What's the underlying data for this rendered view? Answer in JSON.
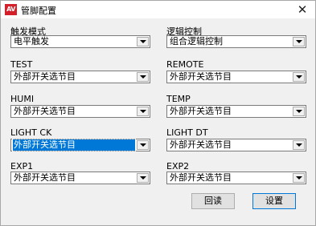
{
  "window": {
    "title": "管脚配置",
    "icon": "app-icon-red"
  },
  "fields": {
    "trigger_mode": {
      "label": "触发模式",
      "value": "电平触发"
    },
    "logic_control": {
      "label": "逻辑控制",
      "value": "组合逻辑控制"
    },
    "test": {
      "label": "TEST",
      "value": "外部开关选节目"
    },
    "remote": {
      "label": "REMOTE",
      "value": "外部开关选节目"
    },
    "humi": {
      "label": "HUMI",
      "value": "外部开关选节目"
    },
    "temp": {
      "label": "TEMP",
      "value": "外部开关选节目"
    },
    "light_ck": {
      "label": "LIGHT CK",
      "value": "外部开关选节目"
    },
    "light_dt": {
      "label": "LIGHT DT",
      "value": "外部开关选节目"
    },
    "exp1": {
      "label": "EXP1",
      "value": "外部开关选节目"
    },
    "exp2": {
      "label": "EXP2",
      "value": "外部开关选节目"
    }
  },
  "buttons": {
    "readback": "回读",
    "set": "设置"
  },
  "colors": {
    "selection": "#0078d7",
    "icon": "#d4202a"
  }
}
